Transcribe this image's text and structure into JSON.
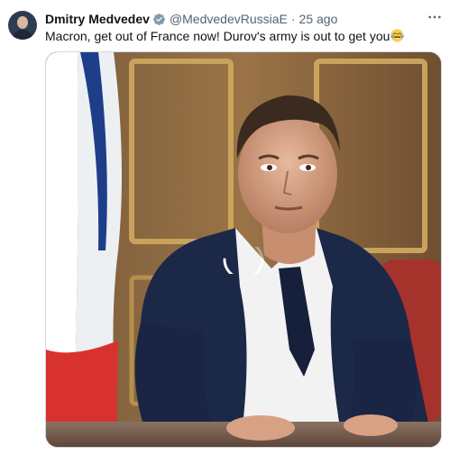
{
  "tweet": {
    "author_name": "Dmitry Medvedev",
    "handle": "@MedvedevRussiaE",
    "separator": "·",
    "time": "25 ago",
    "text": "Macron, get out of France now! Durov's army is out to get you",
    "emoji_icon": "face-with-tears-of-joy-icon",
    "more_icon": "more-horizontal-icon",
    "verified_icon": "verified-badge-icon"
  },
  "colors": {
    "verified": "#829aab",
    "secondary_text": "#536471",
    "text": "#0f1419",
    "media_border": "#cfd9de"
  }
}
